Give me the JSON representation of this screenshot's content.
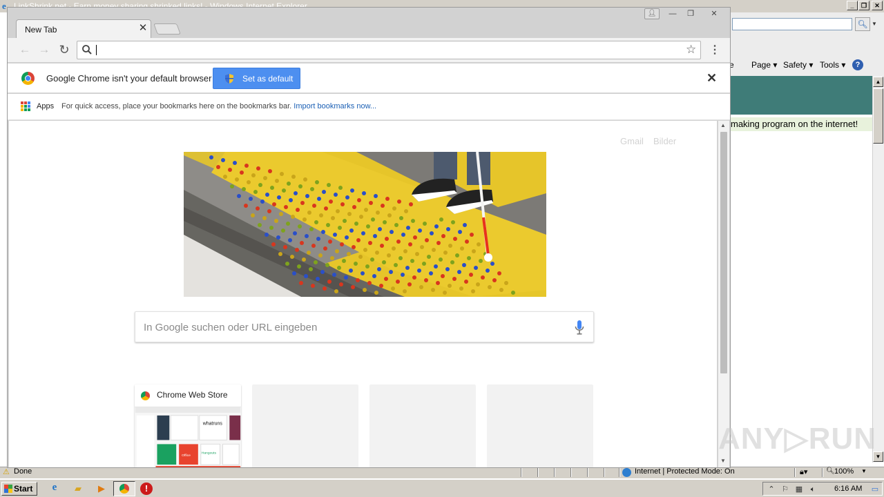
{
  "ie": {
    "title": "LinkShrink.net - Earn money sharing shrinked links! - Windows Internet Explorer",
    "command_bar": {
      "page": "Page ▾",
      "safety": "Safety ▾",
      "tools": "Tools ▾"
    },
    "marquee_text": "making program on the internet!",
    "status_text": "Done",
    "zone_text": "Internet | Protected Mode: On",
    "zoom": "100%"
  },
  "chrome": {
    "tab_title": "New Tab",
    "infobar": {
      "message": "Google Chrome isn't your default browser",
      "button_label": "Set as default"
    },
    "bookmarks": {
      "apps_label": "Apps",
      "hint": "For quick access, place your bookmarks here on the bookmarks bar. ",
      "import_link": "Import bookmarks now..."
    },
    "ntp": {
      "gmail": "Gmail",
      "images": "Bilder",
      "search_placeholder": "In Google suchen oder URL eingeben",
      "tiles": [
        {
          "title": "Chrome Web Store"
        }
      ],
      "thumb_logo_text": "whatruns",
      "thumb_office_text": "Office",
      "thumb_hangouts_text": "Hangouts"
    }
  },
  "watermark": "ANY▷RUN",
  "taskbar": {
    "start_label": "Start",
    "clock": "6:16 AM"
  },
  "colors": {
    "accent_blue": "#4d8ff0",
    "link_blue": "#1a5fb4",
    "ie_teal": "#3f7c78"
  }
}
